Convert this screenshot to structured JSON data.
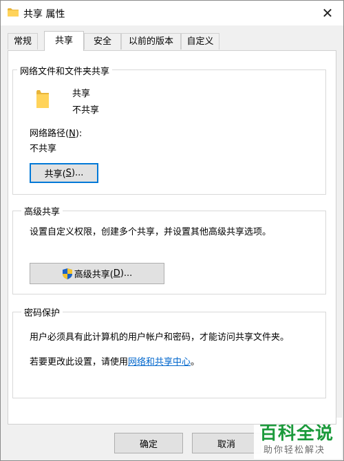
{
  "window": {
    "title": "共享 属性",
    "close_glyph": "✕"
  },
  "tabs": [
    {
      "label": "常规",
      "active": false
    },
    {
      "label": "共享",
      "active": true
    },
    {
      "label": "安全",
      "active": false
    },
    {
      "label": "以前的版本",
      "active": false
    },
    {
      "label": "自定义",
      "active": false
    }
  ],
  "network_sharing": {
    "title": "网络文件和文件夹共享",
    "item_name": "共享",
    "item_status": "不共享",
    "path_label_prefix": "网络路径(",
    "path_label_key": "N",
    "path_label_suffix": "):",
    "path_value": "不共享",
    "share_button_prefix": "共享(",
    "share_button_key": "S",
    "share_button_suffix": ")..."
  },
  "advanced_sharing": {
    "title": "高级共享",
    "description": "设置自定义权限，创建多个共享，并设置其他高级共享选项。",
    "button_prefix": "高级共享(",
    "button_key": "D",
    "button_suffix": ")...",
    "button_icon": "uac-shield-icon"
  },
  "password_protection": {
    "title": "密码保护",
    "description": "用户必须具有此计算机的用户帐户和密码，才能访问共享文件夹。",
    "change_text_prefix": "若要更改此设置，请使用",
    "change_link": "网络和共享中心",
    "change_text_suffix": "。"
  },
  "footer": {
    "ok_label": "确定",
    "cancel_label": "取消"
  },
  "watermark": {
    "main": "百科全说",
    "sub": "助你轻松解决"
  },
  "colors": {
    "link": "#0066cc",
    "folder": "#ffd35a",
    "focus_border": "#0078d7",
    "watermark_green": "#1b9a3b"
  }
}
